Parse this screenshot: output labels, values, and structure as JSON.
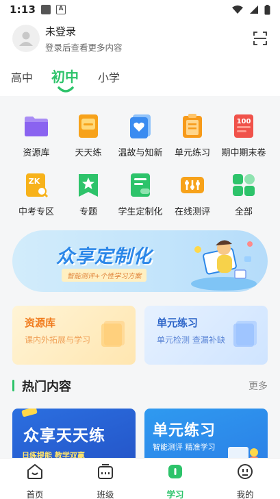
{
  "status_bar": {
    "time": "1:13",
    "letter": "A"
  },
  "header": {
    "user_name": "未登录",
    "user_sub": "登录后查看更多内容"
  },
  "grade_tabs": [
    {
      "label": "高中",
      "active": false
    },
    {
      "label": "初中",
      "active": true
    },
    {
      "label": "小学",
      "active": false
    }
  ],
  "grid": [
    {
      "label": "资源库",
      "icon": "folder-icon",
      "color": "#8a63f0"
    },
    {
      "label": "天天练",
      "icon": "daily-practice-icon",
      "color": "#f7a21a"
    },
    {
      "label": "温故与知新",
      "icon": "review-heart-icon",
      "color": "#3a8bf0"
    },
    {
      "label": "单元练习",
      "icon": "clipboard-icon",
      "color": "#f79a1a"
    },
    {
      "label": "期中期末卷",
      "icon": "exam-100-icon",
      "color": "#f0524a"
    },
    {
      "label": "中考专区",
      "icon": "zk-search-icon",
      "color": "#f7b21a"
    },
    {
      "label": "专题",
      "icon": "star-bookmark-icon",
      "color": "#2dc36a"
    },
    {
      "label": "学生定制化",
      "icon": "customize-icon",
      "color": "#2dc36a"
    },
    {
      "label": "在线测评",
      "icon": "sliders-icon",
      "color": "#f7a21a"
    },
    {
      "label": "全部",
      "icon": "all-grid-icon",
      "color": "#2dc36a"
    }
  ],
  "banner": {
    "title": "众享定制化",
    "subtitle": "智能测评+个性学习方案"
  },
  "cards": [
    {
      "title": "资源库",
      "sub": "课内外拓展与学习"
    },
    {
      "title": "单元练习",
      "sub": "单元检测  查漏补缺"
    }
  ],
  "section": {
    "title": "热门内容",
    "more": "更多"
  },
  "promos": [
    {
      "title": "众享天天练",
      "sub": "日练提能  教学双赢"
    },
    {
      "title": "单元练习",
      "sub": "智能测评  精准学习"
    }
  ],
  "bottom_nav": [
    {
      "label": "首页",
      "icon": "home-icon",
      "active": false
    },
    {
      "label": "班级",
      "icon": "class-icon",
      "active": false
    },
    {
      "label": "学习",
      "icon": "study-icon",
      "active": true
    },
    {
      "label": "我的",
      "icon": "profile-icon",
      "active": false
    }
  ],
  "colors": {
    "accent": "#2dc36a",
    "background": "#f5f6f7"
  }
}
